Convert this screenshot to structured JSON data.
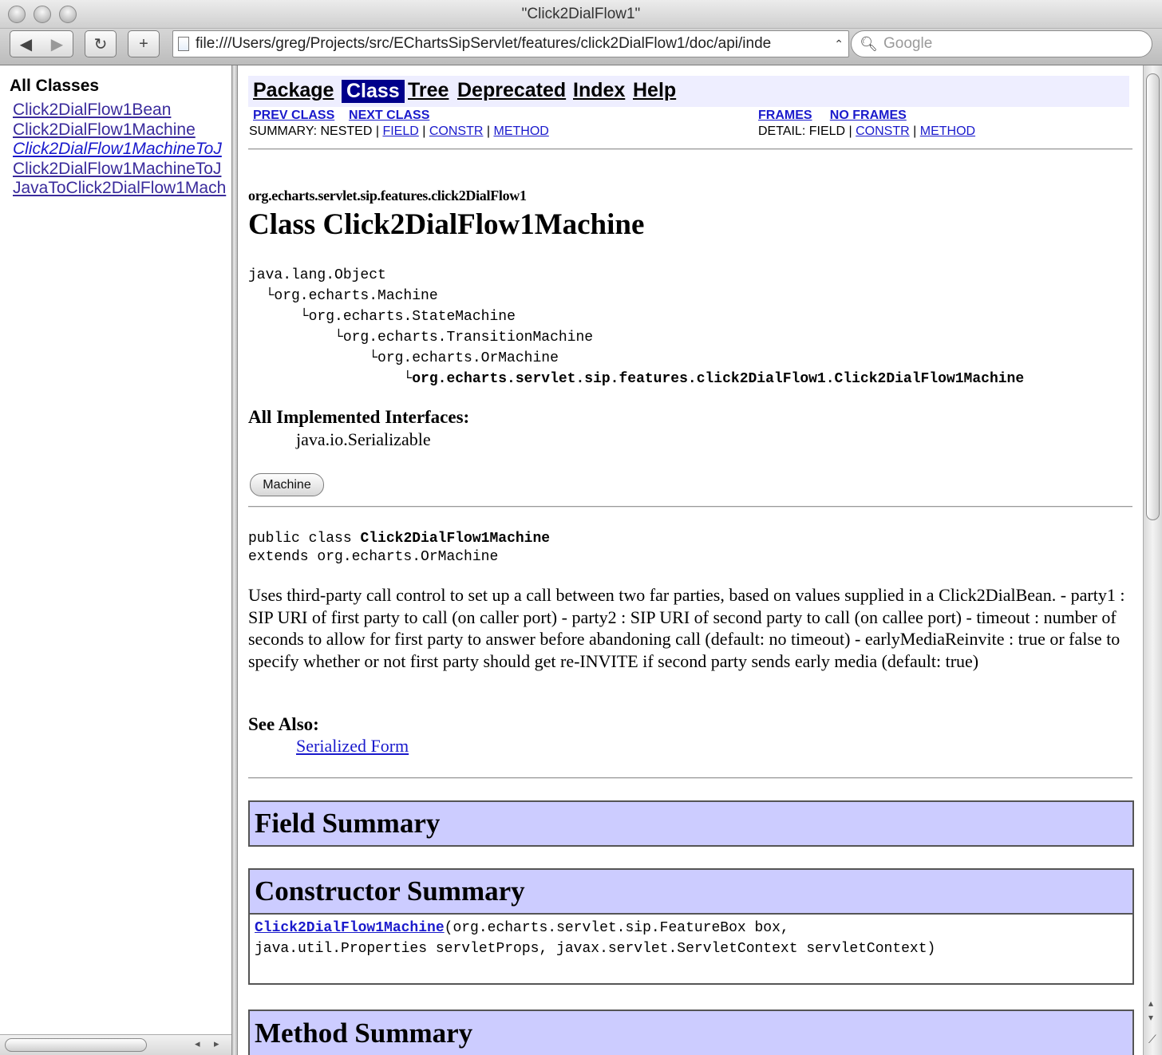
{
  "window": {
    "title": "\"Click2DialFlow1\"",
    "address": "file:///Users/greg/Projects/src/EChartsSipServlet/features/click2DialFlow1/doc/api/inde",
    "search_placeholder": "Google",
    "icons": [
      "back-icon",
      "forward-icon",
      "reload-icon",
      "add-bookmark-icon",
      "search-icon"
    ]
  },
  "left_frame": {
    "heading": "All Classes",
    "classes": [
      {
        "label": "Click2DialFlow1Bean",
        "interface": false
      },
      {
        "label": "Click2DialFlow1Machine",
        "interface": false
      },
      {
        "label": "Click2DialFlow1MachineToJ",
        "interface": true
      },
      {
        "label": "Click2DialFlow1MachineToJ",
        "interface": false
      },
      {
        "label": "JavaToClick2DialFlow1Mach",
        "interface": false
      }
    ]
  },
  "nav": {
    "items": [
      "Package",
      "Class",
      "Tree",
      "Deprecated",
      "Index",
      "Help"
    ],
    "selected": "Class",
    "prev_class": "PREV CLASS",
    "next_class": "NEXT CLASS",
    "frames": "FRAMES",
    "no_frames": "NO FRAMES",
    "summary_label": "SUMMARY: NESTED |",
    "detail_label": "DETAIL: FIELD |",
    "field": "FIELD",
    "constr": "CONSTR",
    "method": "METHOD",
    "sep": "|"
  },
  "class_doc": {
    "package": "org.echarts.servlet.sip.features.click2DialFlow1",
    "title": "Class Click2DialFlow1Machine",
    "hierarchy": [
      "java.lang.Object",
      "org.echarts.Machine",
      "org.echarts.StateMachine",
      "org.echarts.TransitionMachine",
      "org.echarts.OrMachine",
      "org.echarts.servlet.sip.features.click2DialFlow1.Click2DialFlow1Machine"
    ],
    "interfaces_heading": "All Implemented Interfaces:",
    "interfaces": "java.io.Serializable",
    "machine_button": "Machine",
    "decl_prefix": "public class ",
    "decl_name": "Click2DialFlow1Machine",
    "decl_extends": "extends org.echarts.OrMachine",
    "description": "Uses third-party call control to set up a call between two far parties, based on values supplied in a Click2DialBean. - party1 : SIP URI of first party to call (on caller port) - party2 : SIP URI of second party to call (on callee port) - timeout : number of seconds to allow for first party to answer before abandoning call (default: no timeout) - earlyMediaReinvite : true or false to specify whether or not first party should get re-INVITE if second party sends early media (default: true)",
    "see_also_heading": "See Also:",
    "see_also_link": "Serialized Form"
  },
  "summaries": {
    "field": "Field Summary",
    "constructor": "Constructor Summary",
    "constructor_link": "Click2DialFlow1Machine",
    "constructor_sig_1": "(org.echarts.servlet.sip.FeatureBox box,",
    "constructor_sig_2": "java.util.Properties servletProps, javax.servlet.ServletContext servletContext)",
    "method": "Method Summary"
  }
}
